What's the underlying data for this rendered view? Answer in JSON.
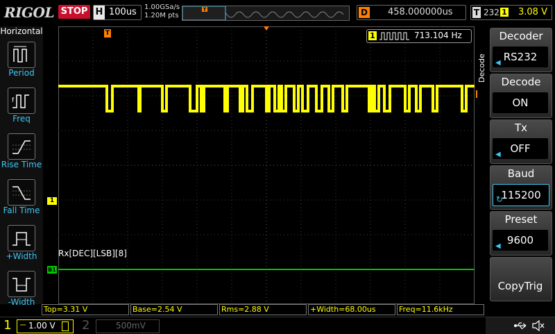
{
  "topbar": {
    "logo": "RIGOL",
    "status": "STOP",
    "horizontal_label": "H",
    "timebase": "100us",
    "sample_rate": "1.00GSa/s",
    "memory_depth": "1.20M pts",
    "delay_label": "D",
    "delay_value": "458.000000us",
    "trigger_label": "T",
    "trigger_type": "232",
    "trigger_source": "1",
    "trigger_level": "3.08 V"
  },
  "left_panel": {
    "title": "Horizontal",
    "items": [
      {
        "label": "Period",
        "icon": "period-icon"
      },
      {
        "label": "Freq",
        "icon": "frequency-icon"
      },
      {
        "label": "Rise Time",
        "icon": "rise-time-icon"
      },
      {
        "label": "Fall Time",
        "icon": "fall-time-icon"
      },
      {
        "label": "+Width",
        "icon": "positive-width-icon"
      },
      {
        "label": "-Width",
        "icon": "negative-width-icon"
      }
    ]
  },
  "waveform": {
    "freq_counter_source": "1",
    "freq_counter_value": "713.104 Hz",
    "decode_label": "Rx[DEC][LSB][8]",
    "ch1_marker": "1",
    "bus_marker": "B1",
    "trigger_marker": "T",
    "colors": {
      "ch1": "#ffff00",
      "bus": "#00c800",
      "trigger": "#ff7f00",
      "grid": "#404040"
    }
  },
  "right_panel": {
    "side_title": "Decode",
    "items": [
      {
        "label": "Decoder",
        "value": "RS232"
      },
      {
        "label": "Decode",
        "value": "ON"
      },
      {
        "label": "Tx",
        "value": "OFF"
      },
      {
        "label": "Baud",
        "value": "115200"
      },
      {
        "label": "Preset",
        "value": "9600"
      },
      {
        "label": "",
        "value": "CopyTrig"
      }
    ]
  },
  "measurements": [
    {
      "text": "Top=3.31 V"
    },
    {
      "text": "Base=2.54 V"
    },
    {
      "text": "Rms=2.88 V"
    },
    {
      "text": "+Width=68.00us"
    },
    {
      "text": "Freq=11.6kHz"
    }
  ],
  "bottombar": {
    "ch1_number": "1",
    "ch1_scale": "1.00 V",
    "ch2_number": "2",
    "ch2_scale": "500mV",
    "usb_icon": "usb-icon",
    "sound_icon": "sound-muted-icon"
  }
}
